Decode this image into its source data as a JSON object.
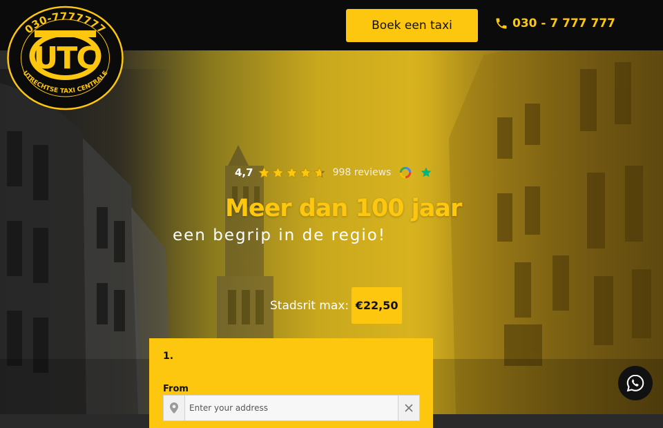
{
  "logo": {
    "phone_text": "030-7777777",
    "monogram": "UTC",
    "tagline": "UTRECHTSE TAXI CENTRALE"
  },
  "header": {
    "book_label": "Boek een taxi",
    "phone_label": "030 - 7 777 777"
  },
  "rating": {
    "score": "4,7",
    "stars": 4.7,
    "reviews": "998 reviews"
  },
  "hero": {
    "headline": "Meer dan 100 jaar",
    "subline": "een begrip in de regio!"
  },
  "price": {
    "label": "Stadsrit max:",
    "value": "€22,50"
  },
  "form": {
    "step": "1.",
    "from_label": "From",
    "address_placeholder": "Enter your address"
  },
  "icons": {
    "phone": "phone-icon",
    "star": "star-icon",
    "google": "google-icon",
    "trustpilot": "trustpilot-star-icon",
    "pin": "map-pin-icon",
    "clear": "close-icon",
    "whatsapp": "whatsapp-icon"
  },
  "colors": {
    "accent": "#fdc60f",
    "topbar": "#0b0b0b"
  }
}
